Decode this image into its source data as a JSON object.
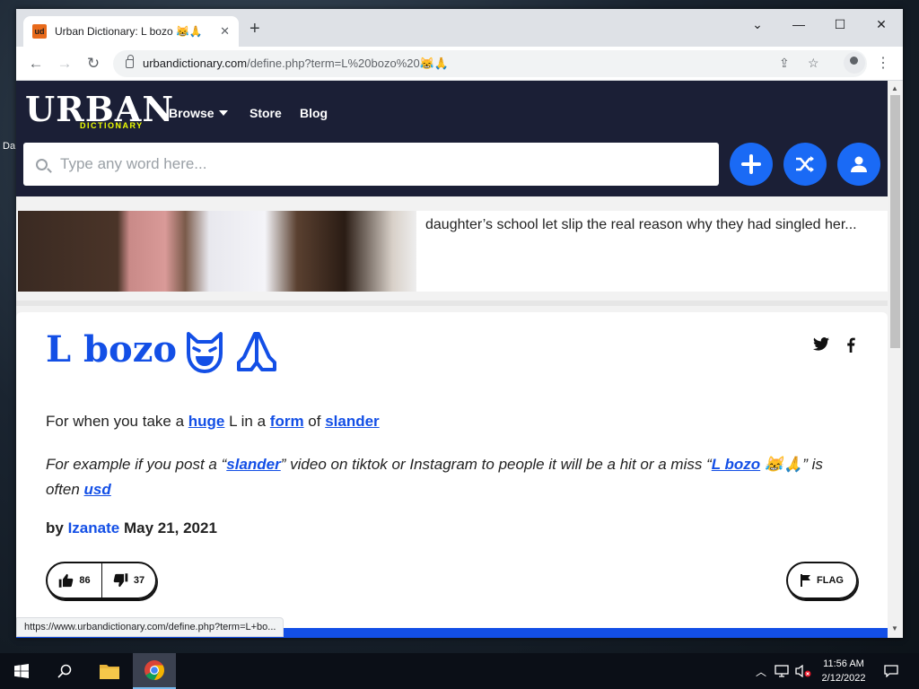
{
  "desktop": {
    "edge_label": "Da"
  },
  "browser": {
    "tab_title": "Urban Dictionary: L bozo 😹🙏",
    "favicon_text": "ud",
    "url_host": "urbandictionary.com",
    "url_path": "/define.php?term=L%20bozo%20😹🙏",
    "status_url": "https://www.urbandictionary.com/define.php?term=L+bo..."
  },
  "header": {
    "logo_word": "URBAN",
    "logo_sub": "DICTIONARY",
    "nav": {
      "browse": "Browse",
      "store": "Store",
      "blog": "Blog"
    },
    "search_placeholder": "Type any word here..."
  },
  "promo": {
    "text": "daughter’s school let slip the real reason why they had singled her..."
  },
  "definition": {
    "word": "L bozo",
    "meaning_parts": [
      "For when you take a ",
      "huge",
      " L in a ",
      "form",
      " of ",
      "slander"
    ],
    "example_parts": [
      "For example if you post a “",
      "slander",
      "” video on tiktok or Instagram to people it will be a hit or a miss “",
      "L bozo",
      " 😹🙏” is often ",
      "usd"
    ],
    "by": "by",
    "author": "Izanate",
    "date": "May 21, 2021",
    "upvotes": "86",
    "downvotes": "37",
    "flag_label": "FLAG"
  },
  "taskbar": {
    "time": "11:56 AM",
    "date": "2/12/2022"
  },
  "colors": {
    "ud_navy": "#1b1f36",
    "ud_blue": "#134fe6",
    "ud_yellow": "#efff00",
    "button_blue": "#1a6af5"
  }
}
